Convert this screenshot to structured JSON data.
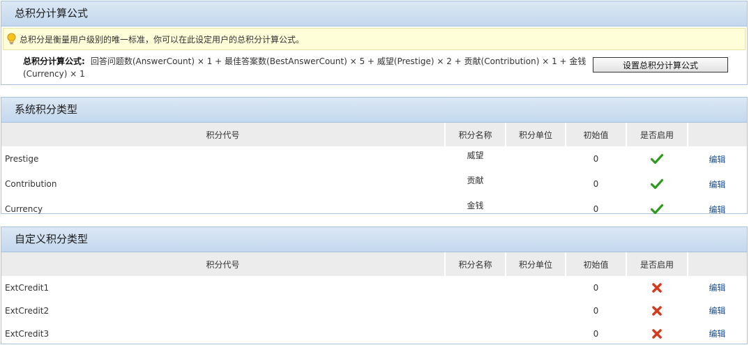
{
  "formula_panel": {
    "title": "总积分计算公式",
    "tip": "总积分是衡量用户级别的唯一标准，你可以在此设定用户的总积分计算公式。",
    "label": "总积分计算公式:",
    "formula": "回答问题数(AnswerCount) × 1 + 最佳答案数(BestAnswerCount) × 5 + 威望(Prestige) × 2 + 贡献(Contribution) × 1 + 金钱(Currency) × 1",
    "button_label": "设置总积分计算公式",
    "tip_icon": "lightbulb-icon"
  },
  "system_panel": {
    "title": "系统积分类型",
    "headers": [
      "积分代号",
      "积分名称",
      "积分单位",
      "初始值",
      "是否启用",
      ""
    ],
    "rows": [
      {
        "code": "Prestige",
        "name": "威望",
        "unit": "",
        "initial": "0",
        "enabled": true,
        "edit": "编辑"
      },
      {
        "code": "Contribution",
        "name": "贡献",
        "unit": "",
        "initial": "0",
        "enabled": true,
        "edit": "编辑"
      },
      {
        "code": "Currency",
        "name": "金钱",
        "unit": "",
        "initial": "0",
        "enabled": true,
        "edit": "编辑"
      }
    ]
  },
  "custom_panel": {
    "title": "自定义积分类型",
    "headers": [
      "积分代号",
      "积分名称",
      "积分单位",
      "初始值",
      "是否启用",
      ""
    ],
    "rows": [
      {
        "code": "ExtCredit1",
        "name": "",
        "unit": "",
        "initial": "0",
        "enabled": false,
        "edit": "编辑"
      },
      {
        "code": "ExtCredit2",
        "name": "",
        "unit": "",
        "initial": "0",
        "enabled": false,
        "edit": "编辑"
      },
      {
        "code": "ExtCredit3",
        "name": "",
        "unit": "",
        "initial": "0",
        "enabled": false,
        "edit": "编辑"
      }
    ]
  },
  "colors": {
    "enabled_check": "#2e9a1f",
    "disabled_cross": "#d63a1a",
    "link": "#1c4e94",
    "header_bg": "#c3d8ee"
  }
}
